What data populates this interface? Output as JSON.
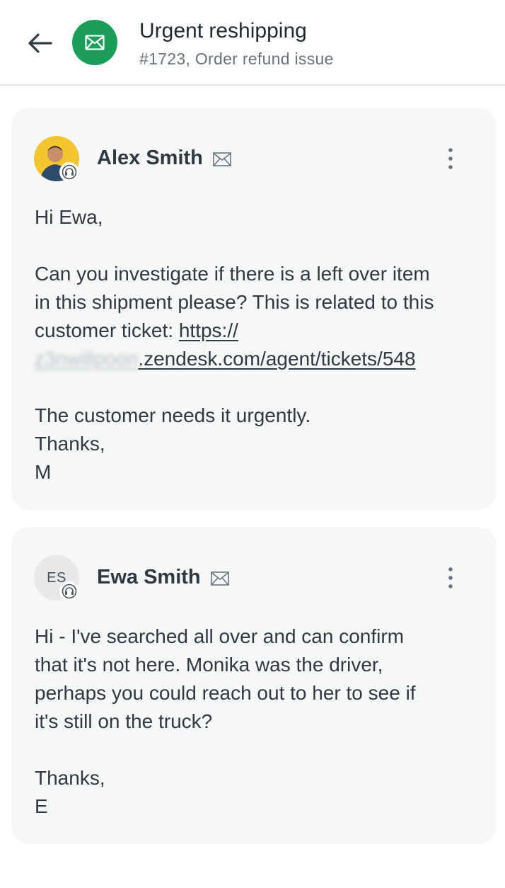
{
  "header": {
    "title": "Urgent reshipping",
    "subtitle": "#1723, Order refund issue",
    "channel_icon": "mail-icon",
    "channel_color": "#1a9e5a"
  },
  "messages": [
    {
      "author": "Alex Smith",
      "avatar": "photo",
      "role_icon": "headset-icon",
      "lines": {
        "greeting": "Hi Ewa,",
        "line1": "Can you investigate if there is a left over item",
        "line2": "in this shipment please? This is related to this",
        "line3_prefix": "customer ticket: ",
        "link_part1": "https://",
        "link_blurred": "z3nwillpoon",
        "link_part2": ".zendesk.com/agent/tickets/548",
        "line5": "The customer needs it urgently.",
        "line6": "Thanks,",
        "line7": "M"
      }
    },
    {
      "author": "Ewa Smith",
      "avatar_initials": "ES",
      "role_icon": "headset-icon",
      "lines": {
        "line1": "Hi - I've searched all over and can confirm",
        "line2": "that it's not here. Monika was the driver,",
        "line3": "perhaps you could reach out to her to see if",
        "line4": "it's still on the truck?",
        "line5": "Thanks,",
        "line6": "E"
      }
    }
  ]
}
